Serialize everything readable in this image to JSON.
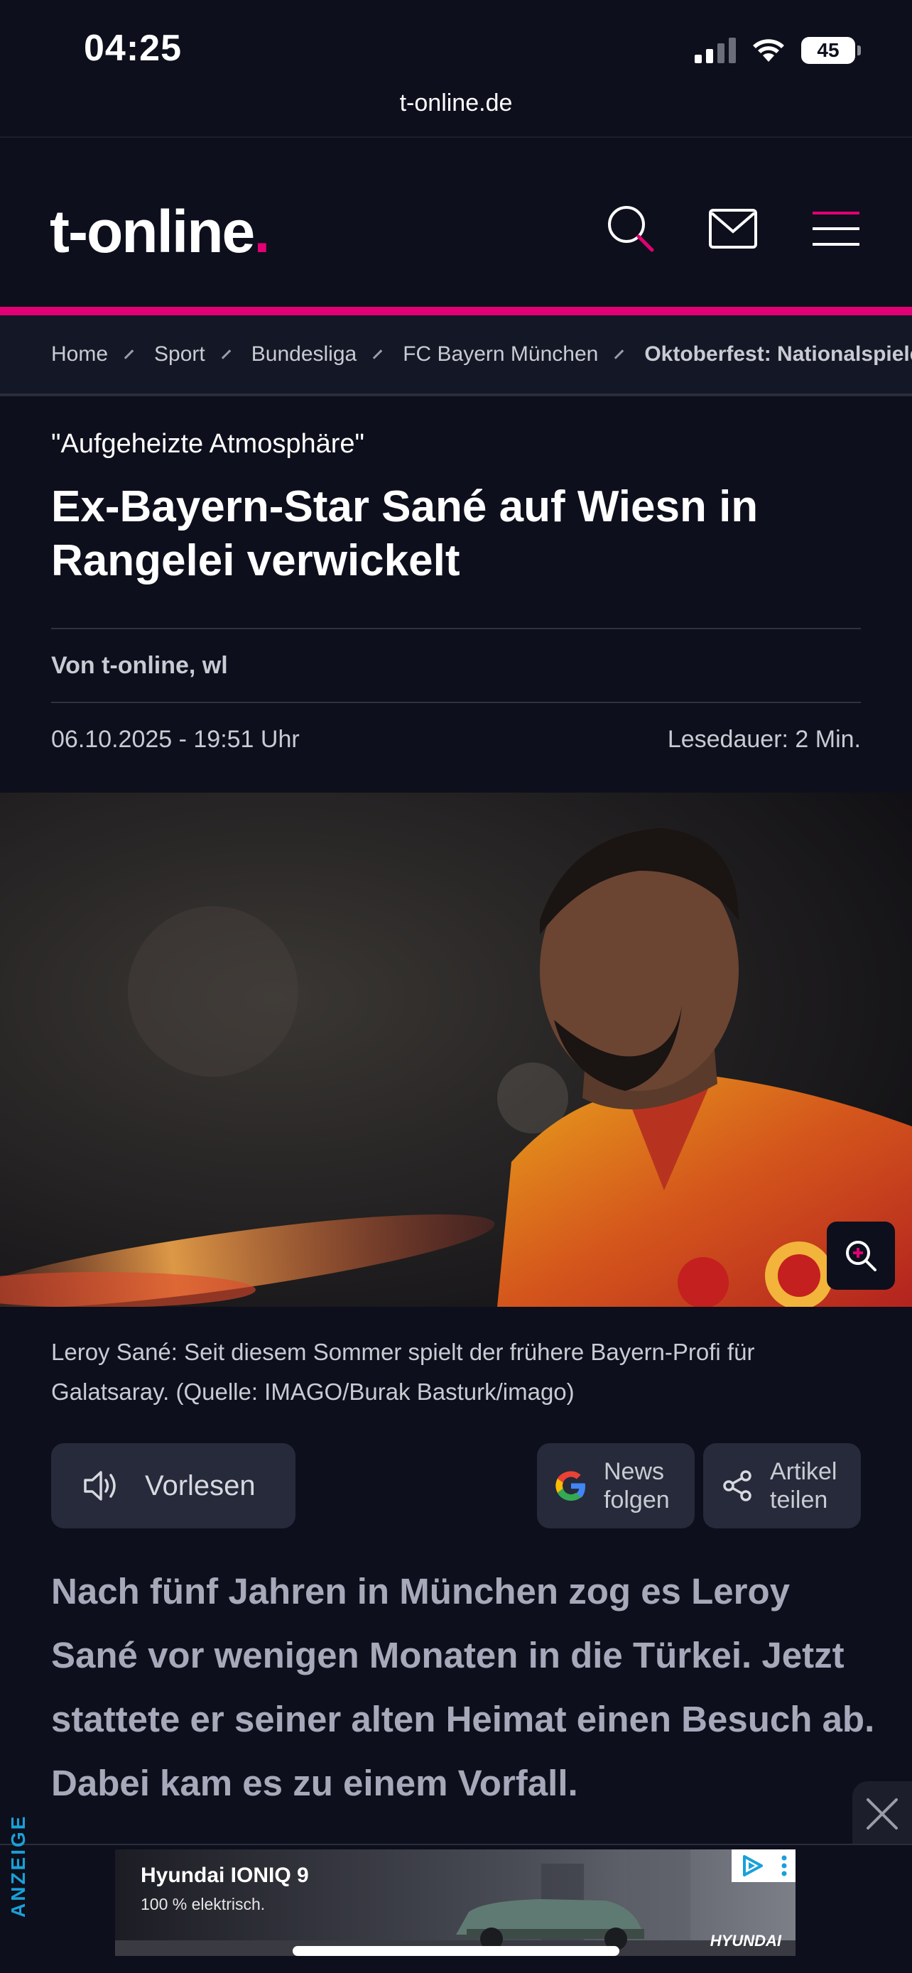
{
  "status_bar": {
    "time": "04:25",
    "battery": "45"
  },
  "browser": {
    "url": "t-online.de"
  },
  "header": {
    "logo_text": "t-online",
    "logo_dot": ".",
    "accent_color": "#e20074"
  },
  "breadcrumb": {
    "items": [
      "Home",
      "Sport",
      "Bundesliga",
      "FC Bayern München"
    ],
    "current": "Oktoberfest: Nationalspieler"
  },
  "article": {
    "kicker": "\"Aufgeheizte Atmosphäre\"",
    "headline": "Ex-Bayern-Star Sané auf Wiesn in Rangelei verwickelt",
    "author": "Von t-online, wl",
    "date": "06.10.2025 - 19:51 Uhr",
    "reading_time": "Lesedauer: 2 Min.",
    "caption": "Leroy Sané: Seit diesem Sommer spielt der frühere Bayern-Profi für Galatsaray. (Quelle: IMAGO/Burak Basturk/imago)",
    "lead": "Nach fünf Jahren in München zog es Leroy Sané vor wenigen Monaten in die Türkei. Jetzt stattete er seiner alten Heimat einen Besuch ab. Dabei kam es zu einem Vorfall."
  },
  "actions": {
    "read_aloud": "Vorlesen",
    "news_follow_line1": "News",
    "news_follow_line2": "folgen",
    "share_line1": "Artikel",
    "share_line2": "teilen"
  },
  "ad": {
    "label": "ANZEIGE",
    "title": "Hyundai IONIQ 9",
    "subtitle": "100 % elektrisch.",
    "brand": "HYUNDAI"
  },
  "icons": {
    "search": "search-icon",
    "mail": "mail-icon",
    "menu": "menu-icon",
    "zoom": "zoom-in-icon",
    "speaker": "speaker-icon",
    "google": "google-icon",
    "share": "share-icon",
    "close": "close-icon"
  }
}
